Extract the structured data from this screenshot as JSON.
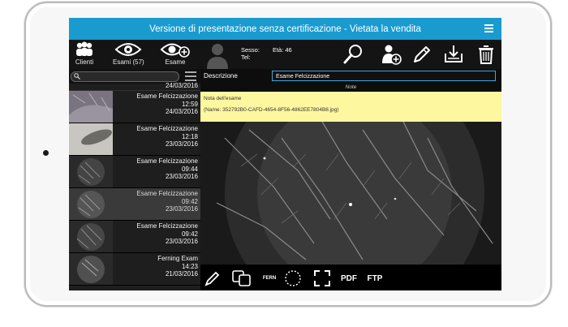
{
  "app": {
    "title": "Versione di presentazione senza certificazione - Vietata la vendita"
  },
  "toolbar": {
    "clients_label": "Clienti",
    "exams_label": "Esami (57)",
    "new_exam_label": "Esame",
    "sex_label": "Sesso:",
    "age_label": "Età: 46",
    "tel_label": "Tel:"
  },
  "list": {
    "items": [
      {
        "title": "",
        "time": "",
        "date": "24/03/2016"
      },
      {
        "title": "Esame Felcizzazione",
        "time": "12:59",
        "date": "24/03/2016"
      },
      {
        "title": "Esame Felcizzazione",
        "time": "12:18",
        "date": "23/03/2016"
      },
      {
        "title": "Esame Felcizzazione",
        "time": "09:44",
        "date": "23/03/2016"
      },
      {
        "title": "Esame Felcizzazione",
        "time": "09:42",
        "date": "23/03/2016"
      },
      {
        "title": "Esame Felcizzazione",
        "time": "09:42",
        "date": "23/03/2016"
      },
      {
        "title": "Ferning Exam",
        "time": "14:23",
        "date": "21/03/2016"
      }
    ]
  },
  "detail": {
    "description_label": "Descrizione",
    "description_value": "Esame Felcizzazione",
    "notes_header": "Note",
    "note_title": "Nota dell'esame",
    "note_name": "(Name: 352792B0-CAFD-4654-8F56-4862EE7804B8.jpg)"
  },
  "bottombar": {
    "fern_label": "FERN",
    "pdf_label": "PDF",
    "ftp_label": "FTP"
  },
  "colors": {
    "title_bar": "#1a9bd0",
    "note_background": "#fdf7a0",
    "input_border": "#3fa8d8"
  }
}
